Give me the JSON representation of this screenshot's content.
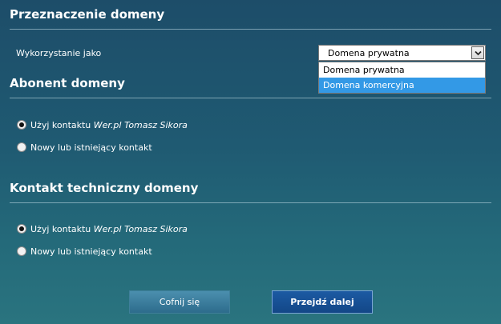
{
  "purpose": {
    "title": "Przeznaczenie domeny",
    "usage_label": "Wykorzystanie jako",
    "select_value": "Domena prywatna",
    "options": [
      "Domena prywatna",
      "Domena komercyjna"
    ]
  },
  "subscriber": {
    "title": "Abonent domeny",
    "use_contact_prefix": "Użyj kontaktu ",
    "contact_name": "Wer.pl Tomasz Sikora",
    "other_contact": "Nowy lub istniejący kontakt"
  },
  "tech": {
    "title": "Kontakt techniczny domeny",
    "use_contact_prefix": "Użyj kontaktu ",
    "contact_name": "Wer.pl Tomasz Sikora",
    "other_contact": "Nowy lub istniejący kontakt"
  },
  "buttons": {
    "back": "Cofnij się",
    "next": "Przejdź dalej"
  },
  "colors": {
    "highlight": "#3399e6",
    "next_button": "#1c5aa3"
  }
}
